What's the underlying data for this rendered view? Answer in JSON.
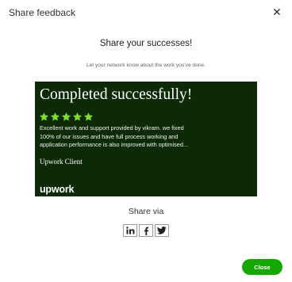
{
  "dialog": {
    "title": "Share feedback",
    "close_icon": "close-icon"
  },
  "content": {
    "heading": "Share your successes!",
    "helper_text": "Let your network know about the work you've done."
  },
  "card": {
    "headline": "Completed successfully!",
    "rating": 5,
    "rating_max": 5,
    "quote_line_1": "Excellent work and support provided by vikram. we fixed",
    "quote_line_2": "100% of our issues and have full process working and",
    "quote_line_3": "application performance is also improved with optimised...",
    "author": "Upwork Client",
    "logo_text": "upwork",
    "background_color": "#0d2a06",
    "star_color": "#7fdc2c"
  },
  "share": {
    "label": "Share via",
    "buttons": [
      {
        "name": "linkedin",
        "icon": "linkedin-icon"
      },
      {
        "name": "facebook",
        "icon": "facebook-icon"
      },
      {
        "name": "twitter",
        "icon": "twitter-icon"
      }
    ]
  },
  "footer": {
    "close_label": "Close",
    "accent_color": "#14a800"
  }
}
